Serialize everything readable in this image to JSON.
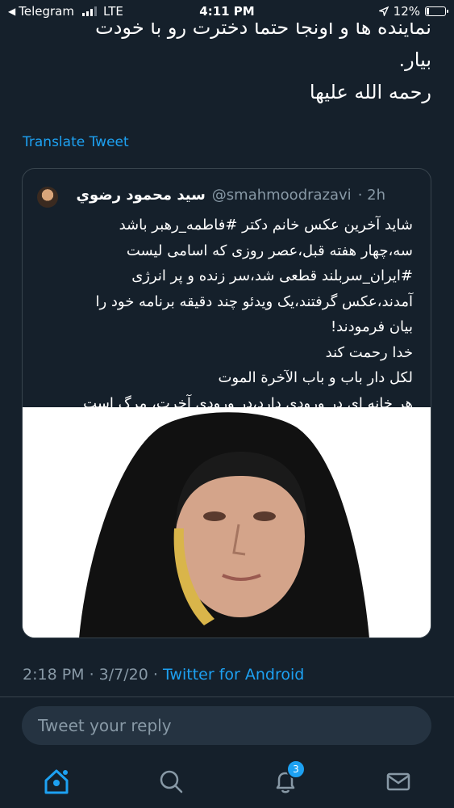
{
  "status_bar": {
    "back_label": "Telegram",
    "network": "LTE",
    "time": "4:11 PM",
    "battery": "12%"
  },
  "tweet": {
    "lines": [
      "نماینده ها و اونجا حتما دخترت رو با خودت",
      "بیار.",
      "رحمه الله علیها"
    ],
    "translate_label": "Translate Tweet",
    "date": "2:18 PM · 3/7/20 ·",
    "source": "Twitter for Android"
  },
  "quoted_tweet": {
    "name": "سید محمود رضوي",
    "handle": "@smahmoodrazavi",
    "time": "· 2h",
    "lines": [
      "شاید آخرین عکس خانم دکتر #فاطمه_رهبر باشد",
      "سه،چهار هفته قبل،عصر روزی که اسامی لیست",
      "#ایران_سربلند قطعی شد،سر زنده و پر انرژی",
      "آمدند،عکس گرفتند،یک ویدئو چند دقیقه برنامه خود را",
      "بیان فرمودند!",
      "خدا رحمت کند",
      "لکل دار باب و باب الآخرة الموت",
      "هر خانه ای در ورودی دارد،در ورودی آخرت، مرگ است"
    ]
  },
  "reply": {
    "placeholder": "Tweet your reply"
  },
  "tabbar": {
    "notifications_badge": "3",
    "icons": [
      "home-icon",
      "search-icon",
      "notifications-icon",
      "messages-icon"
    ]
  },
  "colors": {
    "background": "#15202b",
    "accent": "#1da1f2",
    "muted": "#8899a6",
    "border": "#38444d"
  }
}
